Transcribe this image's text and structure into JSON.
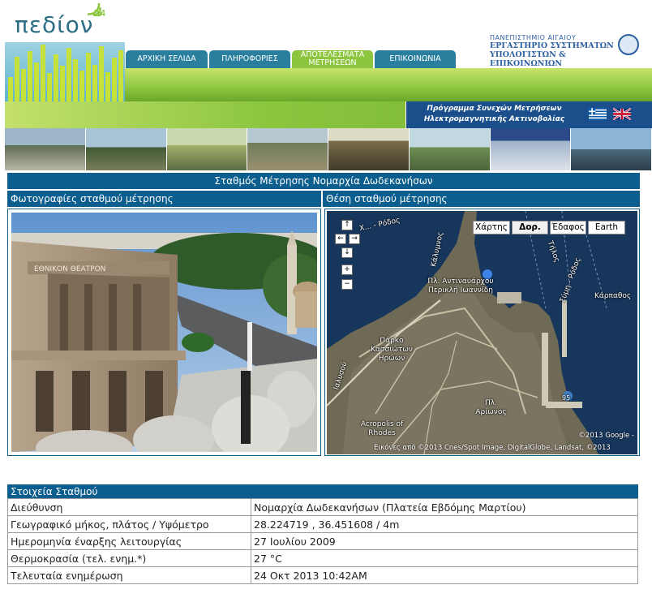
{
  "logo": {
    "text": "πεδίον",
    "sup": "24"
  },
  "tabs": [
    {
      "label": "ΑΡΧΙΚΗ ΣΕΛΙΔΑ"
    },
    {
      "label": "ΠΛΗΡΟΦΟΡΙΕΣ"
    },
    {
      "label_1": "ΑΠΟΤΕΛΕΣΜΑΤΑ",
      "label_2": "ΜΕΤΡΗΣΕΩΝ"
    },
    {
      "label": "ΕΠΙΚΟΙΝΩΝΙΑ"
    }
  ],
  "university": {
    "line1": "ΠΑΝΕΠΙΣΤΗΜΙΟ ΑΙΓΑΙΟΥ",
    "line2": "ΕΡΓΑΣΤΗΡΙΟ ΣΥΣΤΗΜΑΤΩΝ",
    "line3": "ΥΠΟΛΟΓΙΣΤΩΝ & ΕΠΙΚΟΙΝΩΝΙΩΝ"
  },
  "program": {
    "line1": "Πρόγραμμα Συνεχών Μετρήσεων",
    "line2": "Ηλεκτρομαγνητικής Ακτινοβολίας"
  },
  "panel": {
    "title": "Σταθμός Μέτρησης Νομαρχία Δωδεκανήσων",
    "photos_title": "Φωτογραφίες σταθμού μέτρησης",
    "map_title": "Θέση σταθμού μέτρησης",
    "theatre_sign": "ΕΘΝΙΚΟΝ ΘΕΑΤΡΟΝ"
  },
  "map": {
    "buttons": [
      "Χάρτης",
      "Δορ.",
      "Έδαφος",
      "Earth"
    ],
    "selected": "Δορ.",
    "labels": {
      "road_top": "Χ... - Ρόδος",
      "road_right": "Σύμη - Ρόδος",
      "karpathos": "Κάρπαθος",
      "tilos": "Τήλος",
      "kalymnos": "Κάλυμνος",
      "place1": "Πλ. Αντιναυάρχου Περικλή Ιωαννίδη",
      "place2": "Πάρκο Κασσιώτων Ηρώων",
      "place3": "Πλ. Αρίωνος",
      "place4": "Acropolis of Rhodes",
      "ialysou": "Ιαλυσού",
      "route": "95"
    },
    "copyright": "©2013 Google -",
    "attribution": "Εικόνες από ©2013 Cnes/Spot Image, DigitalGlobe, Landsat, ©2013",
    "nav": {
      "up": "↑",
      "left": "←",
      "right": "→",
      "down": "↓",
      "zoom_in": "+",
      "zoom_out": "−"
    }
  },
  "station": {
    "heading": "Στοιχεία Σταθμού",
    "rows": [
      {
        "key": "Διεύθυνση",
        "value": "Νομαρχία Δωδεκανήσων (Πλατεία Εβδόμης Μαρτίου)"
      },
      {
        "key": "Γεωγραφικό μήκος, πλάτος / Υψόμετρο",
        "value": "28.224719 , 36.451608 / 4m"
      },
      {
        "key": "Ημερομηνία έναρξης λειτουργίας",
        "value": "27 Ιουλίου 2009"
      },
      {
        "key": "Θερμοκρασία (τελ. ενημ.*)",
        "value": "27 °C"
      },
      {
        "key": "Τελευταία ενημέρωση",
        "value": "24 Οκτ 2013 10:42AM"
      }
    ]
  },
  "colors": {
    "accent": "#0b5e8e",
    "green": "#8cc63f"
  }
}
